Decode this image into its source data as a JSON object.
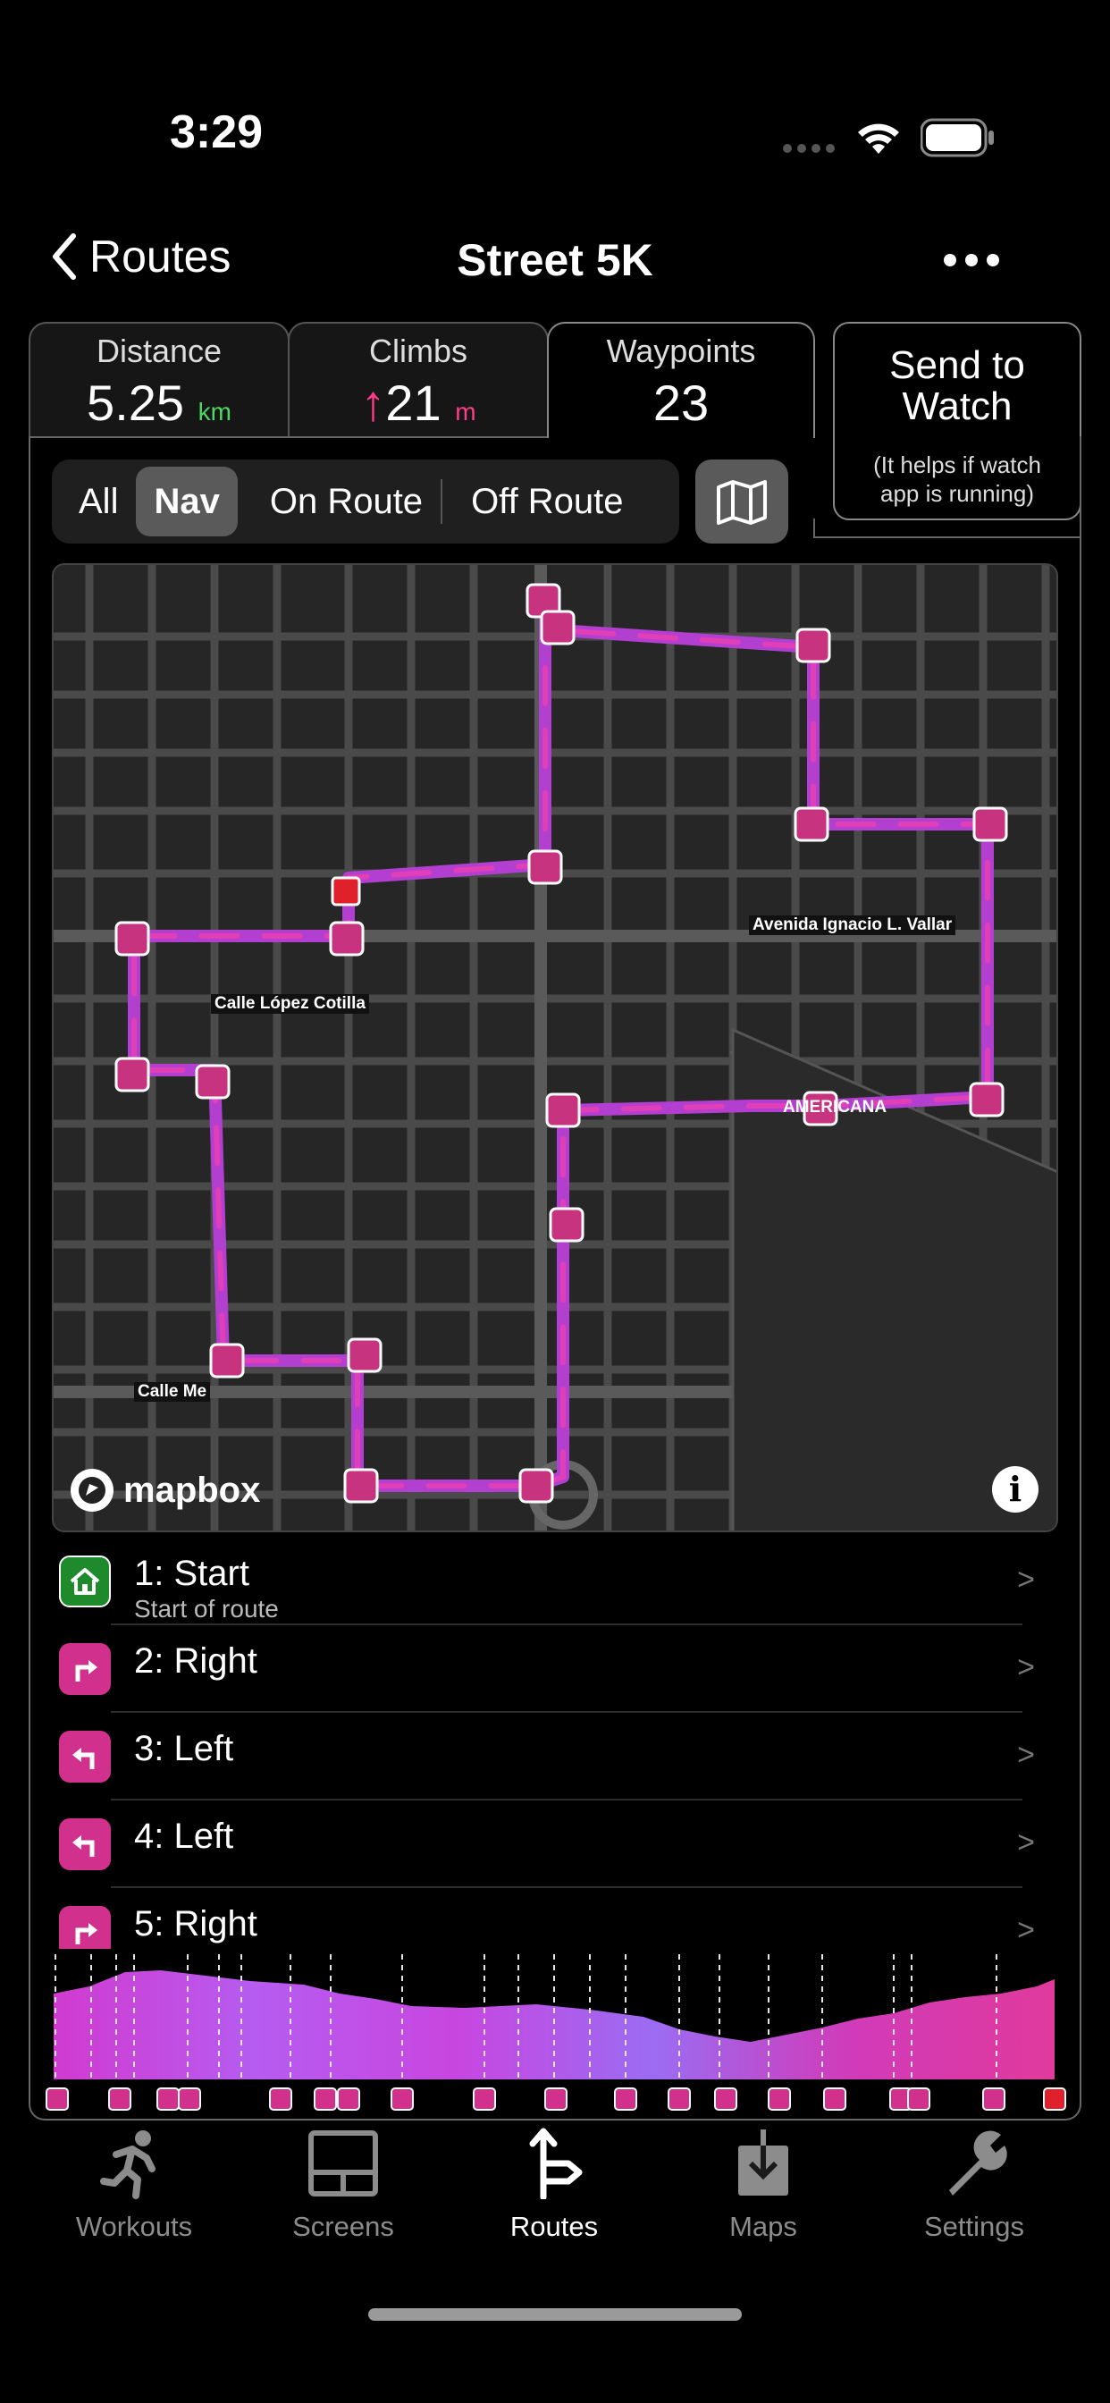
{
  "status": {
    "time": "3:29"
  },
  "nav": {
    "back_label": "Routes",
    "title": "Street 5K"
  },
  "stats": {
    "distance": {
      "label": "Distance",
      "value": "5.25",
      "unit": "km"
    },
    "climbs": {
      "label": "Climbs",
      "arrow": "↑",
      "value": "21",
      "unit": "m"
    },
    "waypoints": {
      "label": "Waypoints",
      "value": "23"
    }
  },
  "send": {
    "title_line1": "Send to",
    "title_line2": "Watch",
    "sub_line1": "(It helps if watch",
    "sub_line2": "app is running)"
  },
  "filter": {
    "items": [
      "All",
      "Nav",
      "On Route",
      "Off Route"
    ],
    "selected": "Nav"
  },
  "map": {
    "labels": [
      "Avenida Ignacio L. Vallar",
      "Calle López Cotilla",
      "AMERICANA",
      "Calle Me"
    ],
    "attribution": "mapbox",
    "info": "i"
  },
  "waypoints": [
    {
      "title": "1: Start",
      "subtitle": "Start of route",
      "icon": "home-icon",
      "chevron": ">"
    },
    {
      "title": "2: Right",
      "subtitle": "",
      "icon": "turn-right-icon",
      "chevron": ">"
    },
    {
      "title": "3: Left",
      "subtitle": "",
      "icon": "turn-left-icon",
      "chevron": ">"
    },
    {
      "title": "4: Left",
      "subtitle": "",
      "icon": "turn-left-icon",
      "chevron": ">"
    },
    {
      "title": "5: Right",
      "subtitle": "",
      "icon": "turn-right-icon",
      "chevron": ">"
    }
  ],
  "tabbar": {
    "items": [
      "Workouts",
      "Screens",
      "Routes",
      "Maps",
      "Settings"
    ],
    "active": "Routes"
  },
  "colors": {
    "accent_pink": "#d1308c",
    "accent_purple": "#9a5cf0",
    "start_green": "#1f8a2c",
    "green_unit": "#4cd964",
    "pink_unit": "#ff3b8b"
  }
}
